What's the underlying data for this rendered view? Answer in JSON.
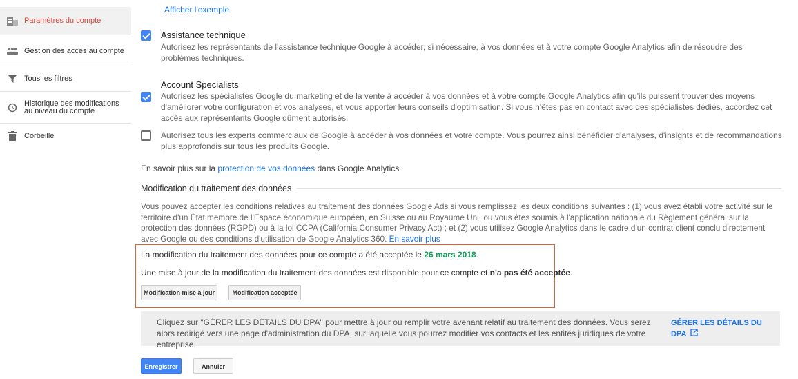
{
  "sidebar": {
    "items": [
      {
        "label": "Paramètres du compte",
        "icon": "building-icon",
        "active": true
      },
      {
        "label": "Gestion des accès au compte",
        "icon": "people-icon",
        "active": false
      },
      {
        "label": "Tous les filtres",
        "icon": "filter-icon",
        "active": false
      },
      {
        "label": "Historique des modifications au niveau du compte",
        "icon": "history-icon",
        "active": false
      },
      {
        "label": "Corbeille",
        "icon": "trash-icon",
        "active": false
      }
    ]
  },
  "main": {
    "show_example_link": "Afficher l'exemple",
    "tech_support": {
      "title": "Assistance technique",
      "description": "Autorisez les représentants de l'assistance technique Google à accéder, si nécessaire, à vos données et à votre compte Google Analytics afin de résoudre des problèmes techniques.",
      "checked": true
    },
    "account_specialists": {
      "title": "Account Specialists",
      "description": "Autorisez les spécialistes Google du marketing et de la vente à accéder à vos données et à votre compte Google Analytics afin qu'ils puissent trouver des moyens d'améliorer votre configuration et vos analyses, et vous apporter leurs conseils d'optimisation. Si vous n'êtes pas en contact avec des spécialistes dédiés, accordez cet accès aux représentants Google dûment autorisés.",
      "checked": true
    },
    "sales_experts": {
      "description": "Autorisez tous les experts commerciaux de Google à accéder à vos données et votre compte. Vous pourrez ainsi bénéficier d'analyses, d'insights et de recommandations plus approfondis sur tous les produits Google.",
      "checked": false
    },
    "learn_more": {
      "prefix": "En savoir plus sur la",
      "link": "protection de vos données",
      "suffix": "dans Google Analytics"
    },
    "dpa_section": {
      "title": "Modification du traitement des données",
      "description": "Vous pouvez accepter les conditions relatives au traitement des données Google Ads si vous remplissez les deux conditions suivantes : (1) vous avez établi votre activité sur le territoire d'un État membre de l'Espace économique européen, en Suisse ou au Royaume Uni, ou vous êtes soumis à l'application nationale du Règlement général sur la protection des données (RGPD) ou à la loi CCPA (California Consumer Privacy Act) ; et (2) vous utilisez Google Analytics dans le cadre d'un contrat client conclu directement avec Google ou des conditions d'utilisation de Google Analytics 360.",
      "learn_more": "En savoir plus",
      "accepted_text": "La modification du traitement des données pour ce compte a été acceptée le",
      "accepted_date": "26 mars 2018",
      "update_text": "Une mise à jour de la modification du traitement des données est disponible pour ce compte et",
      "update_status": "n'a pas été acceptée",
      "btn_update": "Modification mise à jour",
      "btn_accepted": "Modification acceptée"
    },
    "dpa_panel": {
      "text": "Cliquez sur \"GÉRER LES DÉTAILS DU DPA\" pour mettre à jour ou remplir votre avenant relatif au traitement des données. Vous serez alors redirigé vers une page d'administration du DPA, sur laquelle vous pourrez modifier vos contacts et les entités juridiques de votre entreprise.",
      "link": "GÉRER LES DÉTAILS DU DPA"
    },
    "save_label": "Enregistrer",
    "cancel_label": "Annuler"
  },
  "colors": {
    "accent_blue": "#4285f4",
    "link_blue": "#1a73e8",
    "active_red": "#db4437",
    "date_green": "#0f9d58",
    "box_orange": "#e8602c"
  }
}
